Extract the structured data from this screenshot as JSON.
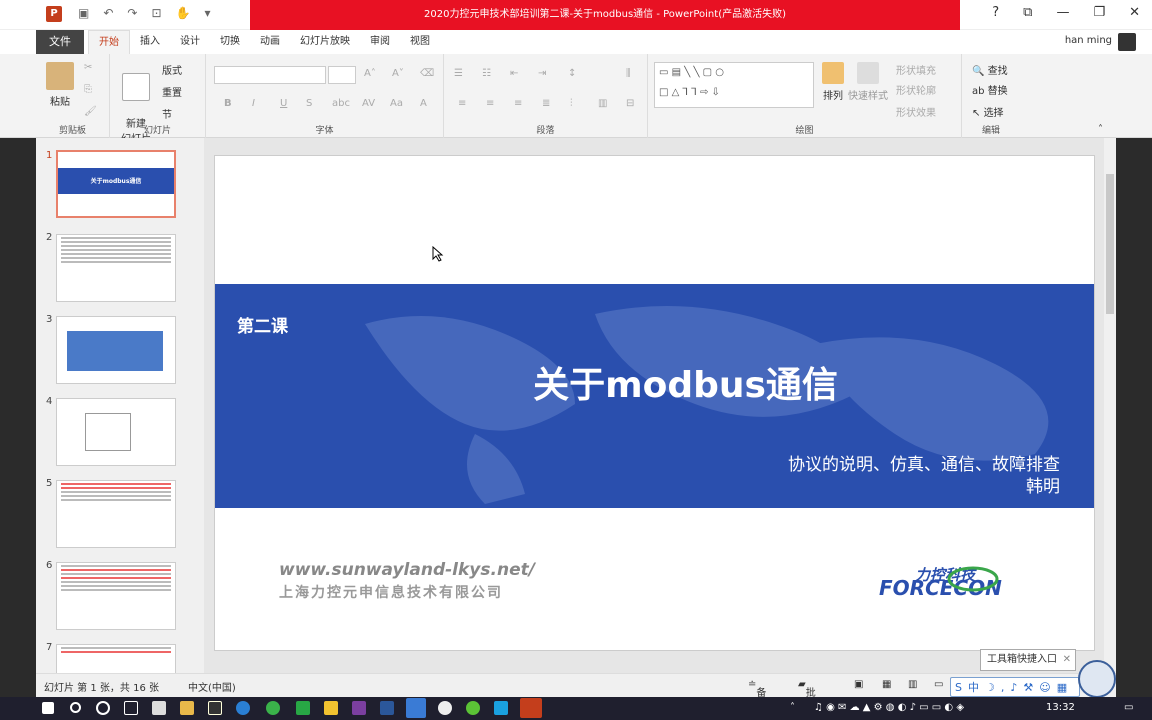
{
  "window": {
    "title": "2020力控元申技术部培训第二课-关于modbus通信 - PowerPoint(产品激活失败)",
    "user": "han ming"
  },
  "menu": {
    "file": "文件",
    "tabs": [
      "开始",
      "插入",
      "设计",
      "切换",
      "动画",
      "幻灯片放映",
      "审阅",
      "视图"
    ]
  },
  "ribbon": {
    "paste": "粘贴",
    "clipboard": "剪贴板",
    "new_slide": "新建\n幻灯片",
    "layout": "版式",
    "reset": "重置",
    "section": "节",
    "slides_group": "幻灯片",
    "font_group": "字体",
    "paragraph_group": "段落",
    "arrange": "排列",
    "quick_styles": "快速样式",
    "shape_fill": "形状填充",
    "shape_outline": "形状轮廓",
    "shape_effects": "形状效果",
    "drawing_group": "绘图",
    "find": "查找",
    "replace": "替换",
    "select": "选择",
    "editing_group": "编辑"
  },
  "thumbnails": [
    {
      "n": "1",
      "title": "关于modbus通信"
    },
    {
      "n": "2",
      "title": ""
    },
    {
      "n": "3",
      "title": ""
    },
    {
      "n": "4",
      "title": ""
    },
    {
      "n": "5",
      "title": ""
    },
    {
      "n": "6",
      "title": ""
    },
    {
      "n": "7",
      "title": ""
    }
  ],
  "slide": {
    "lesson": "第二课",
    "title": "关于modbus通信",
    "subtitle_line1": "协议的说明、仿真、通信、故障排查",
    "subtitle_line2": "韩明",
    "url": "www.sunwayland-lkys.net/",
    "company": "上海力控元申信息技术有限公司",
    "logo_cn": "力控科技",
    "logo_en": "FORCECON"
  },
  "status": {
    "slide_info": "幻灯片 第 1 张，共 16 张",
    "language": "中文(中国)",
    "notes": "备注",
    "comments": "批注"
  },
  "popup": {
    "label": "工具箱快捷入口"
  },
  "taskbar": {
    "time": "13:32"
  },
  "colors": {
    "accent": "#c43e1c",
    "slide_band": "#2a4fae",
    "title_bar": "#e81123"
  }
}
